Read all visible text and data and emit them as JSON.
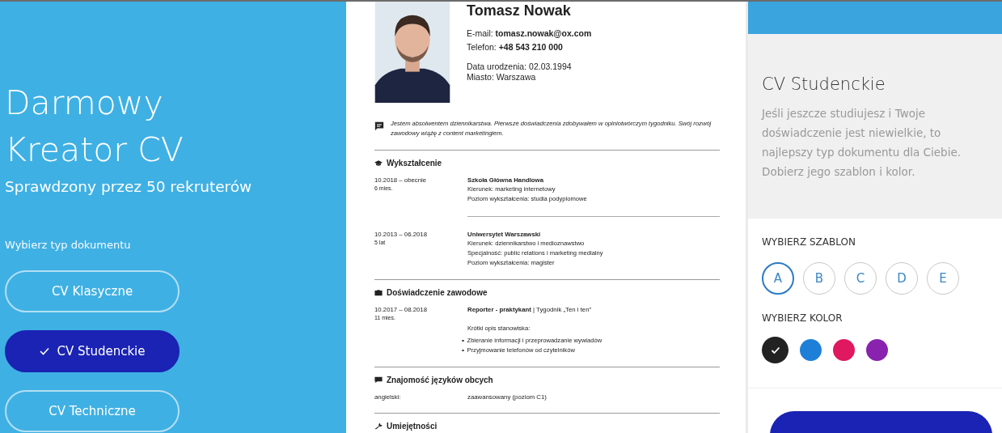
{
  "hero": {
    "title_lines": [
      "Darmowy",
      "Kreator CV"
    ],
    "subtitle": "Sprawdzony przez 50 rekruterów",
    "prompt": "Wybierz typ dokumentu"
  },
  "doc_types": [
    {
      "label": "CV Klasyczne",
      "selected": false
    },
    {
      "label": "CV Studenckie",
      "selected": true
    },
    {
      "label": "CV Techniczne",
      "selected": false
    }
  ],
  "cv": {
    "photo": {
      "kind": "picture"
    },
    "name": "Tomasz Nowak",
    "contact": [
      "E-mail: **tomasz.nowak@ox.com**",
      "Telefon: **+48 543 210 000**"
    ],
    "personal": [
      "Data urodzenia: 02.03.1994",
      "Miasto: Warszawa"
    ],
    "about": "Jestem absolwentem dziennikarstwa. Pierwsze doświadczenia zdobywałem w opiniotwórczym tygodniku. Swój rozwój zawodowy wiążę z content marketingiem.",
    "sections": [
      {
        "kind": "education",
        "title": "Wykształcenie",
        "entries": [
          {
            "dates": "10.2018 – obecnie",
            "duration": "6 mies.",
            "title": "Szkoła Główna Handlowa",
            "lines": [
              "Kierunek: marketing internetowy",
              "Poziom wykształcenia: studia podyplomowe"
            ]
          },
          {
            "dates": "10.2013 – 06.2018",
            "duration": "5 lat",
            "title": "Uniwersytet Warszawski",
            "lines": [
              "Kierunek: dziennikarstwo i medioznawstwo",
              "Specjalność: public relations i marketing medialny",
              "Poziom wykształcenia: magister"
            ]
          }
        ]
      },
      {
        "kind": "experience",
        "title": "Doświadczenie zawodowe",
        "entries": [
          {
            "dates": "10.2017 – 08.2018",
            "duration": "11 mies.",
            "title": "**Reporter - praktykant**  |  Tygodnik „Ten i ten”",
            "lines": [
              "Krótki opis stanowiska:"
            ],
            "bullets": [
              "Zbieranie informacji i przeprowadzanie wywiadów",
              "Przyjmowanie telefonów od czytelników"
            ]
          }
        ]
      },
      {
        "kind": "languages",
        "title": "Znajomość języków obcych",
        "entries": [
          {
            "dates": "angielski:",
            "title": "zaawansowany (poziom C1)"
          }
        ]
      },
      {
        "kind": "skills",
        "title": "Umiejętności"
      }
    ]
  },
  "info": {
    "title": "CV Studenckie",
    "description": "Jeśli jeszcze studiujesz i Twoje doświadczenie jest niewielkie, to najlepszy typ dokumentu dla Ciebie. Dobierz jego szablon i kolor."
  },
  "templates": {
    "label": "WYBIERZ SZABLON",
    "options": [
      {
        "letter": "A",
        "selected": true
      },
      {
        "letter": "B",
        "selected": false
      },
      {
        "letter": "C",
        "selected": false
      },
      {
        "letter": "D",
        "selected": false
      },
      {
        "letter": "E",
        "selected": false
      }
    ]
  },
  "colors": {
    "label": "WYBIERZ KOLOR",
    "options": [
      {
        "color": "#222222",
        "selected": true
      },
      {
        "color": "#1e7fd8",
        "selected": false
      },
      {
        "color": "#e0185f",
        "selected": false
      },
      {
        "color": "#8a22b0",
        "selected": false
      }
    ]
  }
}
